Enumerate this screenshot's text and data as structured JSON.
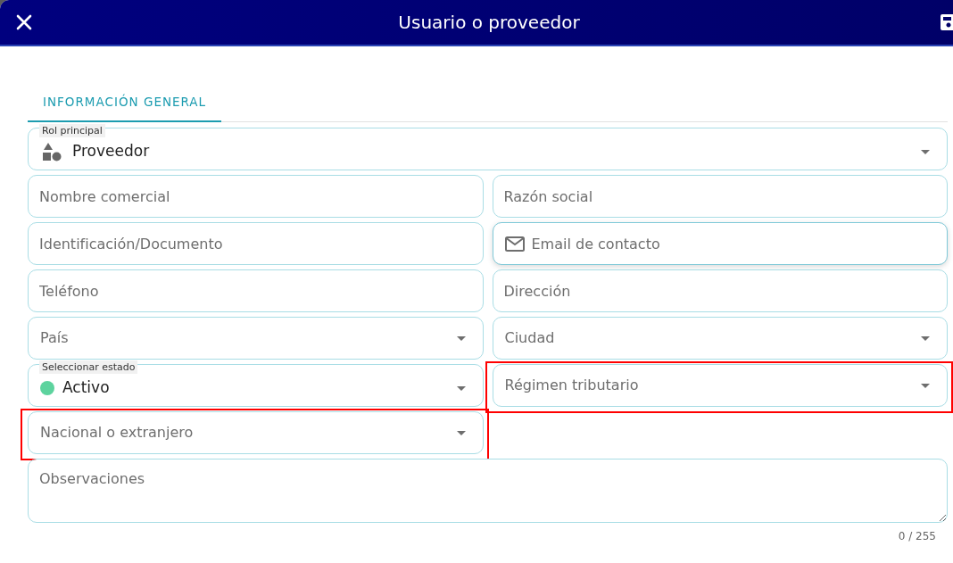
{
  "window": {
    "title": "Usuario o proveedor"
  },
  "tabs": [
    {
      "label": "INFORMACIÓN GENERAL",
      "selected": true
    }
  ],
  "form": {
    "fields": [
      {
        "kind": "role",
        "label": "Rol principal",
        "value": "Proveedor",
        "focused": false,
        "highlighted": false
      },
      {
        "kind": "text",
        "placeholder": "Nombre comercial",
        "focused": false,
        "highlighted": false
      },
      {
        "kind": "text",
        "placeholder": "Razón social",
        "focused": false,
        "highlighted": false
      },
      {
        "kind": "text",
        "placeholder": "Identificación/Documento",
        "focused": false,
        "highlighted": false
      },
      {
        "kind": "email",
        "placeholder": "Email de contacto",
        "focused": true,
        "highlighted": false
      },
      {
        "kind": "text",
        "placeholder": "Teléfono",
        "focused": false,
        "highlighted": false
      },
      {
        "kind": "text",
        "placeholder": "Dirección",
        "focused": false,
        "highlighted": false
      },
      {
        "kind": "select",
        "placeholder": "País",
        "focused": false,
        "highlighted": false
      },
      {
        "kind": "select",
        "placeholder": "Ciudad",
        "focused": false,
        "highlighted": false
      },
      {
        "kind": "status",
        "label": "Seleccionar estado",
        "value": "Activo",
        "color": "#5dd39e",
        "focused": false,
        "highlighted": false
      },
      {
        "kind": "select",
        "placeholder": "Régimen tributario",
        "focused": false,
        "highlighted": true
      },
      {
        "kind": "select",
        "placeholder": "Nacional o extranjero",
        "focused": false,
        "highlighted": true
      },
      {
        "kind": "notes",
        "placeholder": "Observaciones",
        "counter": "0 / 255",
        "focused": false,
        "highlighted": false
      }
    ]
  }
}
